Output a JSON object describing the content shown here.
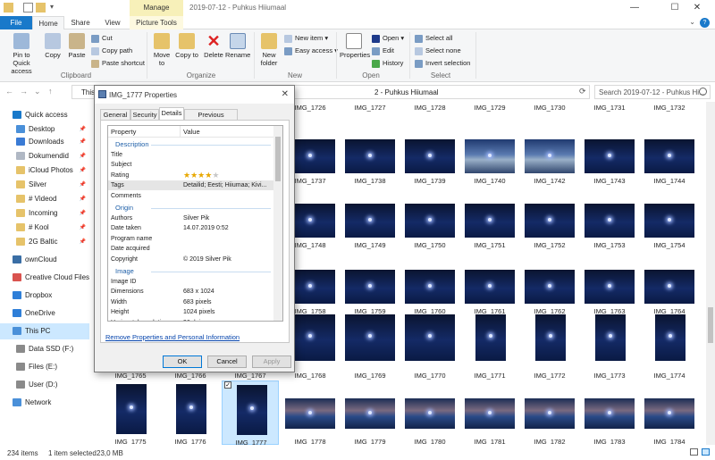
{
  "window": {
    "title": "2019-07-12 - Puhkus Hiiumaal",
    "manage_label": "Manage",
    "minimize": "—",
    "maximize": "☐",
    "close": "✕"
  },
  "ribbon_tabs": {
    "file": "File",
    "home": "Home",
    "share": "Share",
    "view": "View",
    "picture_tools": "Picture Tools",
    "help": "?"
  },
  "ribbon": {
    "clipboard": {
      "label": "Clipboard",
      "pin": "Pin to Quick access",
      "copy": "Copy",
      "paste": "Paste",
      "cut": "Cut",
      "copy_path": "Copy path",
      "paste_shortcut": "Paste shortcut"
    },
    "organize": {
      "label": "Organize",
      "move_to": "Move to",
      "copy_to": "Copy to",
      "delete": "Delete",
      "rename": "Rename"
    },
    "new": {
      "label": "New",
      "new_folder": "New folder",
      "new_item": "New item ▾",
      "easy_access": "Easy access ▾"
    },
    "open": {
      "label": "Open",
      "properties": "Properties",
      "open": "Open ▾",
      "edit": "Edit",
      "history": "History"
    },
    "select": {
      "label": "Select",
      "select_all": "Select all",
      "select_none": "Select none",
      "invert": "Invert selection"
    }
  },
  "address": {
    "this_pc": "This",
    "path": "2 - Puhkus Hiiumaal",
    "search_placeholder": "Search 2019-07-12 - Puhkus Hi..."
  },
  "nav": {
    "items": [
      {
        "label": "Quick access",
        "color": "#1979ca",
        "pin": false
      },
      {
        "label": "Desktop",
        "color": "#4a90d9",
        "pin": true
      },
      {
        "label": "Downloads",
        "color": "#3a7bd5",
        "pin": true
      },
      {
        "label": "Dokumendid",
        "color": "#b0b8c4",
        "pin": true
      },
      {
        "label": "iCloud Photos",
        "color": "#e6c36a",
        "pin": true
      },
      {
        "label": "Silver",
        "color": "#e6c36a",
        "pin": true
      },
      {
        "label": "# Videod",
        "color": "#e6c36a",
        "pin": true
      },
      {
        "label": "Incoming",
        "color": "#e6c36a",
        "pin": true
      },
      {
        "label": "# Kool",
        "color": "#e6c36a",
        "pin": true
      },
      {
        "label": "2G Baltic",
        "color": "#e6c36a",
        "pin": true
      },
      {
        "label": "ownCloud",
        "color": "#3a6ea5",
        "pin": false
      },
      {
        "label": "Creative Cloud Files",
        "color": "#d9534f",
        "pin": false
      },
      {
        "label": "Dropbox",
        "color": "#2f7fd8",
        "pin": false
      },
      {
        "label": "OneDrive",
        "color": "#2f7fd8",
        "pin": false
      },
      {
        "label": "This PC",
        "color": "#4a90d9",
        "pin": false
      },
      {
        "label": "Data SSD (F:)",
        "color": "#8a8a8a",
        "pin": false
      },
      {
        "label": "Files (E:)",
        "color": "#8a8a8a",
        "pin": false
      },
      {
        "label": "User (D:)",
        "color": "#8a8a8a",
        "pin": false
      },
      {
        "label": "Network",
        "color": "#4a90d9",
        "pin": false
      }
    ]
  },
  "files": {
    "rows": [
      [
        "IMG_1726",
        "IMG_1727",
        "IMG_1728",
        "IMG_1729",
        "IMG_1730",
        "IMG_1731",
        "IMG_1732"
      ],
      [
        "IMG_1737",
        "IMG_1738",
        "IMG_1739",
        "IMG_1740",
        "IMG_1742",
        "IMG_1743",
        "IMG_1744"
      ],
      [
        "IMG_1748",
        "IMG_1749",
        "IMG_1750",
        "IMG_1751",
        "IMG_1752",
        "IMG_1753",
        "IMG_1754"
      ],
      [
        "IMG_1758",
        "IMG_1759",
        "IMG_1760",
        "IMG_1761",
        "IMG_1762",
        "IMG_1763",
        "IMG_1764"
      ],
      [
        "IMG_1765",
        "IMG_1766",
        "IMG_1767",
        "IMG_1768",
        "IMG_1769",
        "IMG_1770",
        "IMG_1771",
        "IMG_1772",
        "IMG_1773",
        "IMG_1774"
      ],
      [
        "IMG_1775",
        "IMG_1776",
        "IMG_1777",
        "IMG_1778",
        "IMG_1779",
        "IMG_1780",
        "IMG_1781",
        "IMG_1782",
        "IMG_1783",
        "IMG_1784"
      ]
    ]
  },
  "status": {
    "count": "234 items",
    "selected": "1 item selected",
    "size": "23,0 MB"
  },
  "dialog": {
    "title": "IMG_1777 Properties",
    "close": "✕",
    "tabs": [
      "General",
      "Security",
      "Details",
      "Previous Versions"
    ],
    "header_property": "Property",
    "header_value": "Value",
    "sections": {
      "description": "Description",
      "origin": "Origin",
      "image": "Image"
    },
    "description_rows": [
      {
        "name": "Title",
        "value": ""
      },
      {
        "name": "Subject",
        "value": ""
      },
      {
        "name": "Rating",
        "value": ""
      },
      {
        "name": "Tags",
        "value": "Detailid; Eesti; Hiiumaa; Kivi..."
      },
      {
        "name": "Comments",
        "value": ""
      }
    ],
    "rating_value": 4,
    "origin_rows": [
      {
        "name": "Authors",
        "value": "Silver Pik"
      },
      {
        "name": "Date taken",
        "value": "14.07.2019 0:52"
      },
      {
        "name": "Program name",
        "value": ""
      },
      {
        "name": "Date acquired",
        "value": ""
      },
      {
        "name": "Copyright",
        "value": "© 2019 Silver Pik"
      }
    ],
    "image_rows": [
      {
        "name": "Image ID",
        "value": ""
      },
      {
        "name": "Dimensions",
        "value": "683 x 1024"
      },
      {
        "name": "Width",
        "value": "683 pixels"
      },
      {
        "name": "Height",
        "value": "1024 pixels"
      },
      {
        "name": "Horizontal resolution",
        "value": "96 dpi"
      }
    ],
    "remove_link": "Remove Properties and Personal Information",
    "ok": "OK",
    "cancel": "Cancel",
    "apply": "Apply"
  }
}
